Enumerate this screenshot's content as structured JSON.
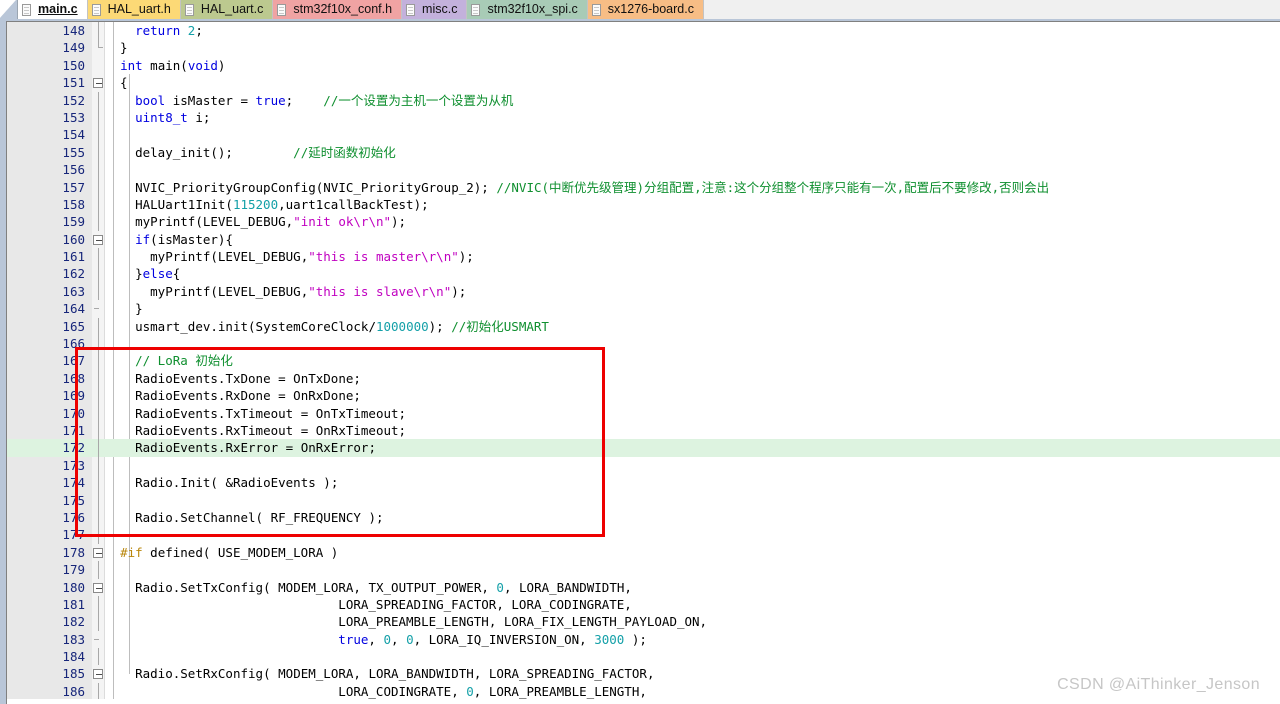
{
  "window": {
    "app_kind": "code-editor",
    "colors": {
      "active_tab_bg": "#ffffff",
      "highlight_line_bg": "#ddf3e0",
      "annotation_red": "#ee0000",
      "keyword_blue": "#0000e0",
      "string_magenta": "#c000c0",
      "comment_green": "#0f8f2f",
      "number_teal": "#14a0a8",
      "linenumber_navy": "#17267a",
      "gutter_bg": "#e8e8e8"
    }
  },
  "tabbar": {
    "tabs": [
      {
        "label": "main.c",
        "active": true,
        "bg": "#ffffff"
      },
      {
        "label": "HAL_uart.h",
        "active": false,
        "bg": "#fcd976"
      },
      {
        "label": "HAL_uart.c",
        "active": false,
        "bg": "#bcc98f"
      },
      {
        "label": "stm32f10x_conf.h",
        "active": false,
        "bg": "#f0a3a3"
      },
      {
        "label": "misc.c",
        "active": false,
        "bg": "#c3b1dc"
      },
      {
        "label": "stm32f10x_spi.c",
        "active": false,
        "bg": "#a8cbb6"
      },
      {
        "label": "sx1276-board.c",
        "active": false,
        "bg": "#f7bd85"
      }
    ],
    "doc_icon": "document-icon"
  },
  "editor": {
    "first_line": 148,
    "highlighted_line": 172,
    "lines": [
      {
        "n": 148,
        "fold": "end",
        "indent": 1,
        "text": "    return 2;"
      },
      {
        "n": 149,
        "fold": "elbow",
        "indent": 0,
        "text": "  }"
      },
      {
        "n": 150,
        "fold": "none",
        "indent": 0,
        "text": "  int main(void)"
      },
      {
        "n": 151,
        "fold": "box",
        "indent": 0,
        "text": "  {"
      },
      {
        "n": 152,
        "fold": "line",
        "indent": 1,
        "text": "    bool isMaster = true;    //一个设置为主机一个设置为从机"
      },
      {
        "n": 153,
        "fold": "line",
        "indent": 1,
        "text": "    uint8_t i;"
      },
      {
        "n": 154,
        "fold": "line",
        "indent": 1,
        "text": ""
      },
      {
        "n": 155,
        "fold": "line",
        "indent": 1,
        "text": "    delay_init();        //延时函数初始化"
      },
      {
        "n": 156,
        "fold": "line",
        "indent": 1,
        "text": ""
      },
      {
        "n": 157,
        "fold": "line",
        "indent": 1,
        "text": "    NVIC_PriorityGroupConfig(NVIC_PriorityGroup_2); //NVIC(中断优先级管理)分组配置,注意:这个分组整个程序只能有一次,配置后不要修改,否则会出"
      },
      {
        "n": 158,
        "fold": "line",
        "indent": 1,
        "text": "    HALUart1Init(115200,uart1callBackTest);"
      },
      {
        "n": 159,
        "fold": "line",
        "indent": 1,
        "text": "    myPrintf(LEVEL_DEBUG,\"init ok\\r\\n\");"
      },
      {
        "n": 160,
        "fold": "box",
        "indent": 1,
        "text": "    if(isMaster){"
      },
      {
        "n": 161,
        "fold": "line",
        "indent": 2,
        "text": "      myPrintf(LEVEL_DEBUG,\"this is master\\r\\n\");"
      },
      {
        "n": 162,
        "fold": "line",
        "indent": 1,
        "text": "    }else{"
      },
      {
        "n": 163,
        "fold": "line",
        "indent": 2,
        "text": "      myPrintf(LEVEL_DEBUG,\"this is slave\\r\\n\");"
      },
      {
        "n": 164,
        "fold": "tick",
        "indent": 1,
        "text": "    }"
      },
      {
        "n": 165,
        "fold": "line",
        "indent": 1,
        "text": "    usmart_dev.init(SystemCoreClock/1000000); //初始化USMART"
      },
      {
        "n": 166,
        "fold": "line",
        "indent": 1,
        "text": ""
      },
      {
        "n": 167,
        "fold": "line",
        "indent": 1,
        "text": "    // LoRa 初始化"
      },
      {
        "n": 168,
        "fold": "line",
        "indent": 1,
        "text": "    RadioEvents.TxDone = OnTxDone;"
      },
      {
        "n": 169,
        "fold": "line",
        "indent": 1,
        "text": "    RadioEvents.RxDone = OnRxDone;"
      },
      {
        "n": 170,
        "fold": "line",
        "indent": 1,
        "text": "    RadioEvents.TxTimeout = OnTxTimeout;"
      },
      {
        "n": 171,
        "fold": "line",
        "indent": 1,
        "text": "    RadioEvents.RxTimeout = OnRxTimeout;"
      },
      {
        "n": 172,
        "fold": "line",
        "indent": 1,
        "text": "    RadioEvents.RxError = OnRxError;"
      },
      {
        "n": 173,
        "fold": "line",
        "indent": 1,
        "text": ""
      },
      {
        "n": 174,
        "fold": "line",
        "indent": 1,
        "text": "    Radio.Init( &RadioEvents );"
      },
      {
        "n": 175,
        "fold": "line",
        "indent": 1,
        "text": ""
      },
      {
        "n": 176,
        "fold": "line",
        "indent": 1,
        "text": "    Radio.SetChannel( RF_FREQUENCY );"
      },
      {
        "n": 177,
        "fold": "line",
        "indent": 1,
        "text": ""
      },
      {
        "n": 178,
        "fold": "box",
        "indent": 0,
        "text": "  #if defined( USE_MODEM_LORA )"
      },
      {
        "n": 179,
        "fold": "line",
        "indent": 1,
        "text": ""
      },
      {
        "n": 180,
        "fold": "box",
        "indent": 1,
        "text": "    Radio.SetTxConfig( MODEM_LORA, TX_OUTPUT_POWER, 0, LORA_BANDWIDTH,"
      },
      {
        "n": 181,
        "fold": "line",
        "indent": 1,
        "text": "                               LORA_SPREADING_FACTOR, LORA_CODINGRATE,"
      },
      {
        "n": 182,
        "fold": "line",
        "indent": 1,
        "text": "                               LORA_PREAMBLE_LENGTH, LORA_FIX_LENGTH_PAYLOAD_ON,"
      },
      {
        "n": 183,
        "fold": "tick",
        "indent": 1,
        "text": "                               true, 0, 0, LORA_IQ_INVERSION_ON, 3000 );"
      },
      {
        "n": 184,
        "fold": "line",
        "indent": 1,
        "text": ""
      },
      {
        "n": 185,
        "fold": "box",
        "indent": 1,
        "text": "    Radio.SetRxConfig( MODEM_LORA, LORA_BANDWIDTH, LORA_SPREADING_FACTOR,"
      },
      {
        "n": 186,
        "fold": "line",
        "indent": 1,
        "text": "                               LORA_CODINGRATE, 0, LORA_PREAMBLE_LENGTH,"
      }
    ]
  },
  "annotation": {
    "type": "red-rectangle",
    "covers_lines": "166-177",
    "label": "lora-init-highlight-box"
  },
  "watermark": {
    "text": "CSDN @AiThinker_Jenson"
  }
}
